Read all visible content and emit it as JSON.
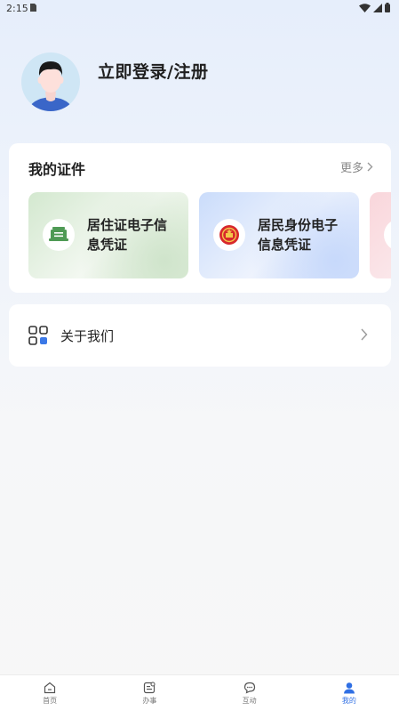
{
  "status_bar": {
    "time": "2:15"
  },
  "profile": {
    "login_label": "立即登录/注册"
  },
  "certificates": {
    "title": "我的证件",
    "more_label": "更多",
    "items": [
      {
        "label": "居住证电子信息凭证",
        "icon": "residence-permit-icon"
      },
      {
        "label": "居民身份电子信息凭证",
        "icon": "national-emblem-icon"
      }
    ]
  },
  "about": {
    "label": "关于我们"
  },
  "bottom_nav": {
    "items": [
      {
        "label": "首页",
        "icon": "home-icon"
      },
      {
        "label": "办事",
        "icon": "tasks-icon"
      },
      {
        "label": "互动",
        "icon": "chat-icon"
      },
      {
        "label": "我的",
        "icon": "user-icon",
        "active": true
      }
    ]
  },
  "colors": {
    "accent": "#2f6fe4",
    "green": "#4f9a55",
    "red": "#d8282c"
  }
}
